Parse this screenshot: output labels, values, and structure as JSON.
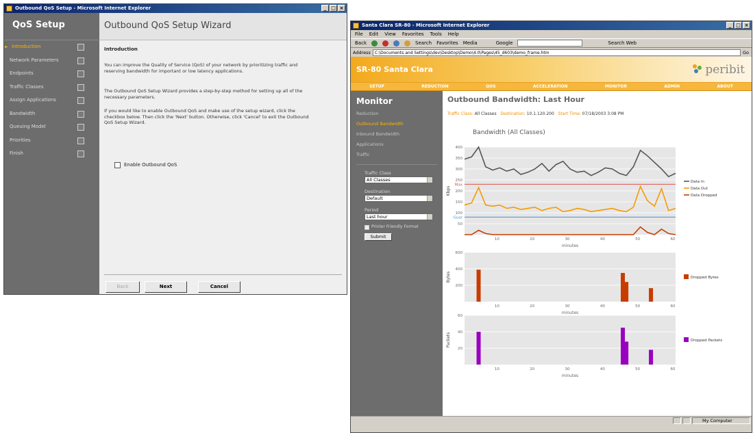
{
  "wizard": {
    "title": "Outbound QoS Setup - Microsoft Internet Explorer",
    "brand": "QoS Setup",
    "heading": "Outbound QoS Setup Wizard",
    "subheading": "Introduction",
    "steps": [
      "Introduction",
      "Network Parameters",
      "Endpoints",
      "Traffic Classes",
      "Assign Applications",
      "Bandwidth",
      "Queuing Model",
      "Priorities",
      "Finish"
    ],
    "paragraphs": [
      "You can improve the Quality of Service (QoS) of your network by prioritizing traffic and reserving bandwidth for important or low latency applications.",
      "The Outbound QoS Setup Wizard provides a step-by-step method for setting up all of the necessary parameters.",
      "If you would like to enable Outbound QoS and make use of the setup wizard, click the checkbox below. Then click the 'Next' button. Otherwise, click 'Cancel' to exit the Outbound QoS Setup Wizard."
    ],
    "checkbox_label": "Enable Outbound QoS",
    "back_label": "Back",
    "next_label": "Next",
    "cancel_label": "Cancel",
    "window_buttons": [
      "_",
      "□",
      "×"
    ]
  },
  "browser": {
    "title": "Santa Clara SR-80 - Microsoft Internet Explorer",
    "menu": [
      "File",
      "Edit",
      "View",
      "Favorites",
      "Tools",
      "Help"
    ],
    "toolbar": [
      "Back",
      "Search",
      "Favorites",
      "Media"
    ],
    "address_label": "Address",
    "address": "C:\\Documents and Settings\\dev\\Desktop\\Demo\\4.0\\Pages\\45_d603\\demo_frame.htm",
    "go_label": "Go",
    "google_label": "Google",
    "search_web_label": "Search Web",
    "status_left": "",
    "status_zone": "My Computer"
  },
  "site": {
    "header_title": "SR-80 Santa Clara",
    "logo": "peribit",
    "nav": [
      "SETUP",
      "REDUCTION",
      "QOS",
      "ACCELERATION",
      "MONITOR",
      "ADMIN",
      "ABOUT"
    ],
    "sidebar_title": "Monitor",
    "sidebar_links": [
      "Reduction",
      "Outbound Bandwidth",
      "Inbound Bandwidth",
      "Applications",
      "Traffic"
    ],
    "traffic_class_label": "Traffic Class",
    "traffic_class_value": "All Classes",
    "destination_label": "Destination",
    "destination_value": "Default",
    "period_label": "Period",
    "period_value": "Last hour",
    "printer_friendly_label": "Printer Friendly Format",
    "submit_label": "Submit",
    "page_heading": "Outbound Bandwidth: Last Hour",
    "info_traffic_label": "Traffic Class:",
    "info_traffic_value": "All Classes",
    "info_dest_label": "Destination:",
    "info_dest_value": "10.1.120.200",
    "info_start_label": "Start Time:",
    "info_start_value": "07/18/2003 3:08 PM",
    "chart_title": "Bandwidth (All Classes)"
  },
  "chart_data": [
    {
      "type": "line",
      "title": "Bandwidth (All Classes)",
      "xlabel": "minutes",
      "ylabel": "Kbps",
      "x": [
        0,
        2,
        4,
        6,
        8,
        10,
        12,
        14,
        16,
        18,
        20,
        22,
        24,
        26,
        28,
        30,
        32,
        34,
        36,
        38,
        40,
        42,
        44,
        46,
        48,
        50,
        52,
        54,
        56,
        58,
        60
      ],
      "xticks": [
        "10",
        "20",
        "30",
        "40",
        "50",
        "60"
      ],
      "yticks": [
        "50",
        "100",
        "150",
        "200",
        "250",
        "300",
        "350",
        "400"
      ],
      "ylim": [
        0,
        400
      ],
      "reference_lines": [
        {
          "label": "Max",
          "value": 230,
          "color": "#e05050"
        },
        {
          "label": "Guar",
          "value": 80,
          "color": "#4a90d0"
        }
      ],
      "series": [
        {
          "name": "Data In",
          "color": "#555555",
          "values": [
            345,
            355,
            400,
            310,
            295,
            305,
            290,
            300,
            275,
            285,
            300,
            325,
            290,
            320,
            335,
            300,
            285,
            290,
            270,
            285,
            305,
            300,
            280,
            270,
            310,
            385,
            360,
            330,
            300,
            265,
            280
          ]
        },
        {
          "name": "Data Out",
          "color": "#f59a00",
          "values": [
            135,
            145,
            215,
            135,
            130,
            135,
            120,
            125,
            115,
            120,
            125,
            110,
            120,
            125,
            105,
            110,
            120,
            115,
            105,
            110,
            115,
            120,
            110,
            105,
            125,
            220,
            155,
            130,
            210,
            110,
            120
          ]
        },
        {
          "name": "Data Dropped",
          "color": "#c83c00",
          "values": [
            0,
            0,
            20,
            5,
            0,
            0,
            0,
            0,
            0,
            0,
            0,
            0,
            0,
            0,
            0,
            0,
            0,
            0,
            0,
            0,
            0,
            0,
            0,
            0,
            0,
            35,
            10,
            0,
            25,
            5,
            0
          ]
        }
      ],
      "legend": "right"
    },
    {
      "type": "bar",
      "xlabel": "minutes",
      "ylabel": "Bytes",
      "ylim": [
        0,
        600
      ],
      "yticks": [
        "200",
        "400",
        "600"
      ],
      "xticks": [
        "10",
        "20",
        "30",
        "40",
        "50",
        "60"
      ],
      "color": "#c83c00",
      "series": [
        {
          "name": "Dropped Bytes",
          "x": [
            4,
            45,
            46,
            53
          ],
          "values": [
            390,
            350,
            240,
            165
          ]
        }
      ],
      "legend": "right"
    },
    {
      "type": "bar",
      "xlabel": "minutes",
      "ylabel": "Packets",
      "ylim": [
        0,
        60
      ],
      "yticks": [
        "20",
        "40",
        "60"
      ],
      "xticks": [
        "10",
        "20",
        "30",
        "40",
        "50",
        "60"
      ],
      "color": "#9a00c0",
      "series": [
        {
          "name": "Dropped Packets",
          "x": [
            4,
            45,
            46,
            53
          ],
          "values": [
            40,
            45,
            28,
            18
          ]
        }
      ],
      "legend": "right"
    }
  ]
}
